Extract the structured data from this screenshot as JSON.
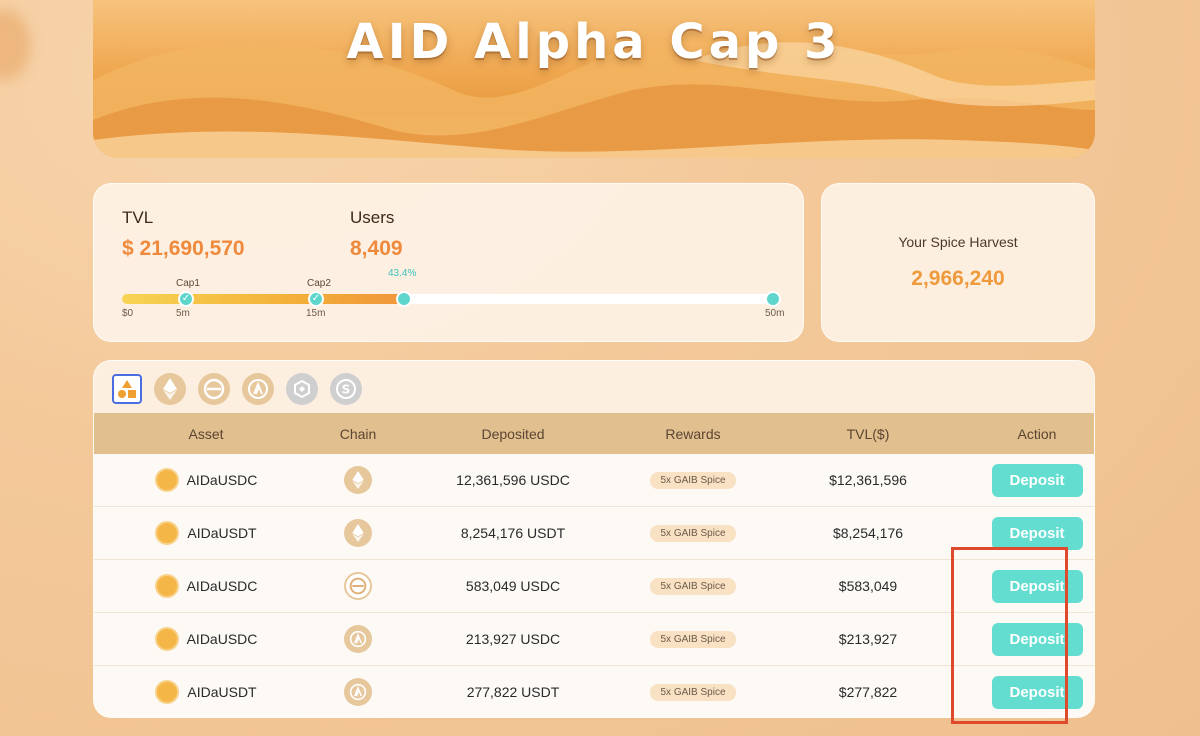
{
  "hero": {
    "title": "AID Alpha Cap 3"
  },
  "stats": {
    "tvl_label": "TVL",
    "tvl_value": "$ 21,690,570",
    "users_label": "Users",
    "users_value": "8,409",
    "progress": {
      "percent_label": "43.4%",
      "fill_fraction": 0.434,
      "cap1_label": "Cap1",
      "cap2_label": "Cap2",
      "ticks": [
        "$0",
        "5m",
        "15m",
        "50m"
      ]
    }
  },
  "harvest": {
    "label": "Your Spice Harvest",
    "value": "2,966,240"
  },
  "chain_filters": [
    "all-icon",
    "ethereum-icon",
    "chain-circle-icon",
    "arbitrum-icon",
    "bnb-icon",
    "s-chain-icon"
  ],
  "table": {
    "headers": [
      "Asset",
      "Chain",
      "Deposited",
      "Rewards",
      "TVL($)",
      "Action"
    ],
    "rows": [
      {
        "asset": "AIDaUSDC",
        "chain_icon": "ethereum-icon",
        "deposited": "12,361,596 USDC",
        "rewards": "5x GAIB Spice",
        "tvl": "$12,361,596",
        "action": "Deposit"
      },
      {
        "asset": "AIDaUSDT",
        "chain_icon": "ethereum-icon",
        "deposited": "8,254,176 USDT",
        "rewards": "5x GAIB Spice",
        "tvl": "$8,254,176",
        "action": "Deposit"
      },
      {
        "asset": "AIDaUSDC",
        "chain_icon": "chain-circle-icon",
        "deposited": "583,049 USDC",
        "rewards": "5x GAIB Spice",
        "tvl": "$583,049",
        "action": "Deposit"
      },
      {
        "asset": "AIDaUSDC",
        "chain_icon": "arbitrum-icon",
        "deposited": "213,927 USDC",
        "rewards": "5x GAIB Spice",
        "tvl": "$213,927",
        "action": "Deposit"
      },
      {
        "asset": "AIDaUSDT",
        "chain_icon": "arbitrum-icon",
        "deposited": "277,822 USDT",
        "rewards": "5x GAIB Spice",
        "tvl": "$277,822",
        "action": "Deposit"
      }
    ]
  },
  "colors": {
    "accent": "#ef8a3c",
    "button": "#64ddd1",
    "highlight": "#e04a2c"
  }
}
